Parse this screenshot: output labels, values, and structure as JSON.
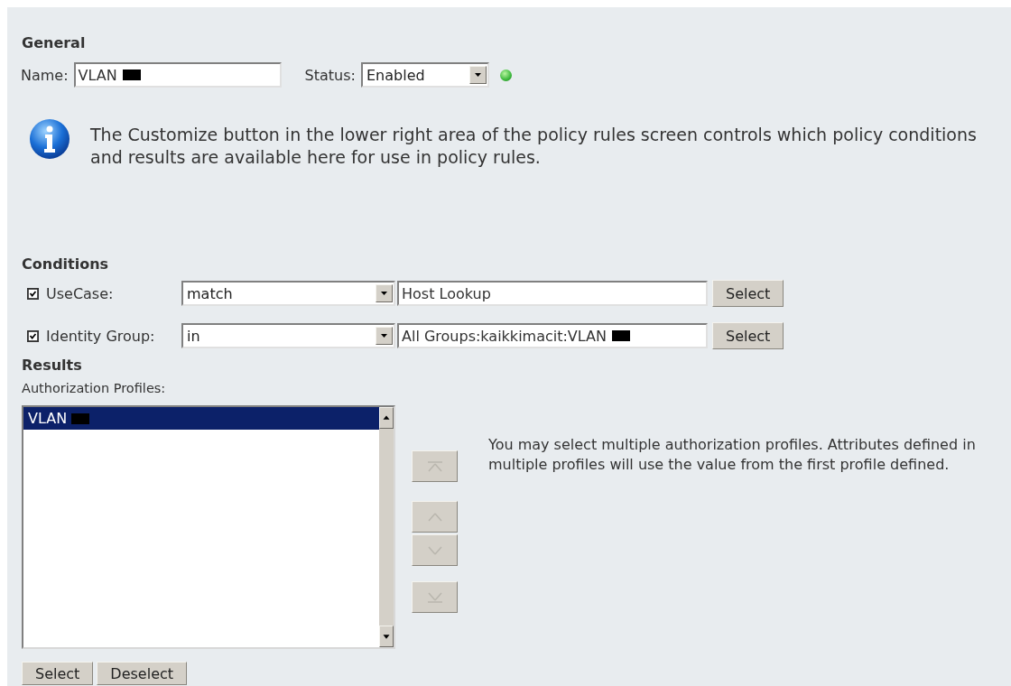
{
  "general": {
    "heading": "General",
    "name": {
      "label": "Name:",
      "value": "VLAN",
      "redacted": true
    },
    "status": {
      "label": "Status:",
      "value": "Enabled",
      "indicator_on": true
    }
  },
  "info": {
    "text": "The Customize button in the lower right area of the policy rules screen controls which policy conditions and results are available here for use in policy rules."
  },
  "conditions": {
    "heading": "Conditions",
    "rows": [
      {
        "checked": true,
        "label": "UseCase:",
        "operator": "match",
        "value": "Host Lookup",
        "redacted": false,
        "button": "Select"
      },
      {
        "checked": true,
        "label": "Identity Group:",
        "operator": "in",
        "value": "All Groups:kaikkimacit:VLAN",
        "redacted": true,
        "button": "Select"
      }
    ]
  },
  "results": {
    "heading": "Results",
    "list_label": "Authorization Profiles:",
    "items": [
      {
        "label": "VLAN",
        "redacted": true,
        "selected": true
      }
    ],
    "order_buttons": [
      {
        "kind": "top",
        "disabled": true
      },
      {
        "kind": "up",
        "disabled": true
      },
      {
        "kind": "down",
        "disabled": true
      },
      {
        "kind": "bottom",
        "disabled": true
      }
    ],
    "note": "You may select multiple authorization profiles. Attributes defined in multiple profiles will use the value from the first profile defined.",
    "buttons": [
      "Select",
      "Deselect"
    ]
  }
}
